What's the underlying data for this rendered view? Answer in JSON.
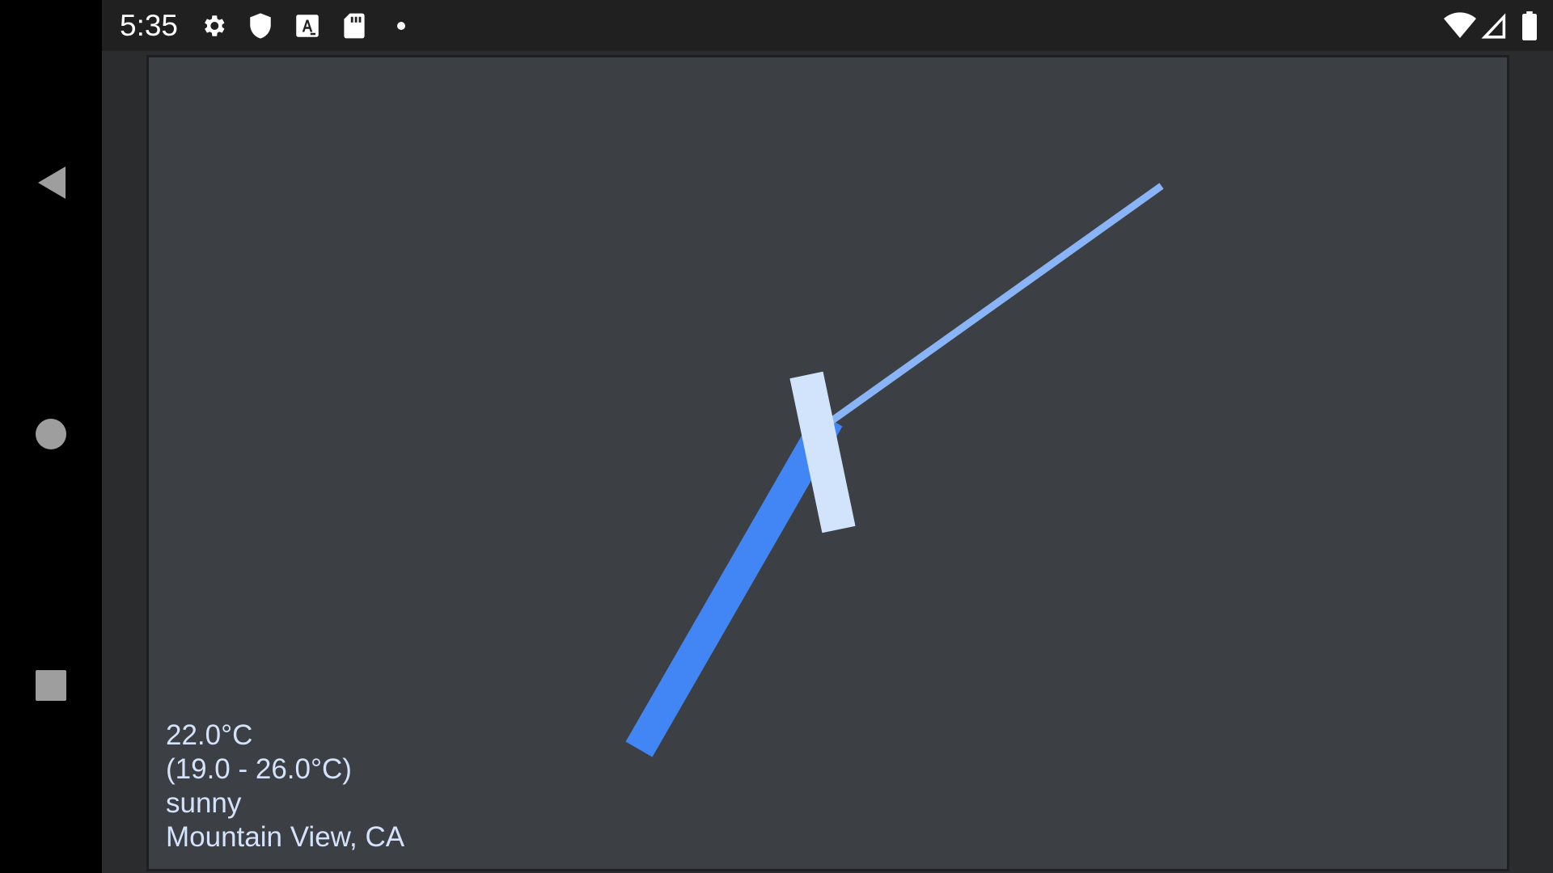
{
  "status_bar": {
    "time": "5:35",
    "left_icons": [
      "settings-icon",
      "shield-icon",
      "text-a-icon",
      "sd-card-icon",
      "dot-icon"
    ],
    "right_icons": [
      "wifi-icon",
      "cell-signal-icon",
      "battery-icon"
    ]
  },
  "navigation": {
    "buttons": [
      "back-icon",
      "home-icon",
      "recents-icon"
    ]
  },
  "watch_face": {
    "hands": {
      "hour_hand_color": "#4285f4",
      "minute_hand_color": "#d2e3fc",
      "second_hand_color": "#8ab4f8"
    },
    "weather": {
      "temperature": "22.0°C",
      "range": "(19.0 - 26.0°C)",
      "condition": "sunny",
      "location": "Mountain View, CA"
    },
    "background_color": "#3c4044",
    "text_color": "#d5e2fb"
  }
}
